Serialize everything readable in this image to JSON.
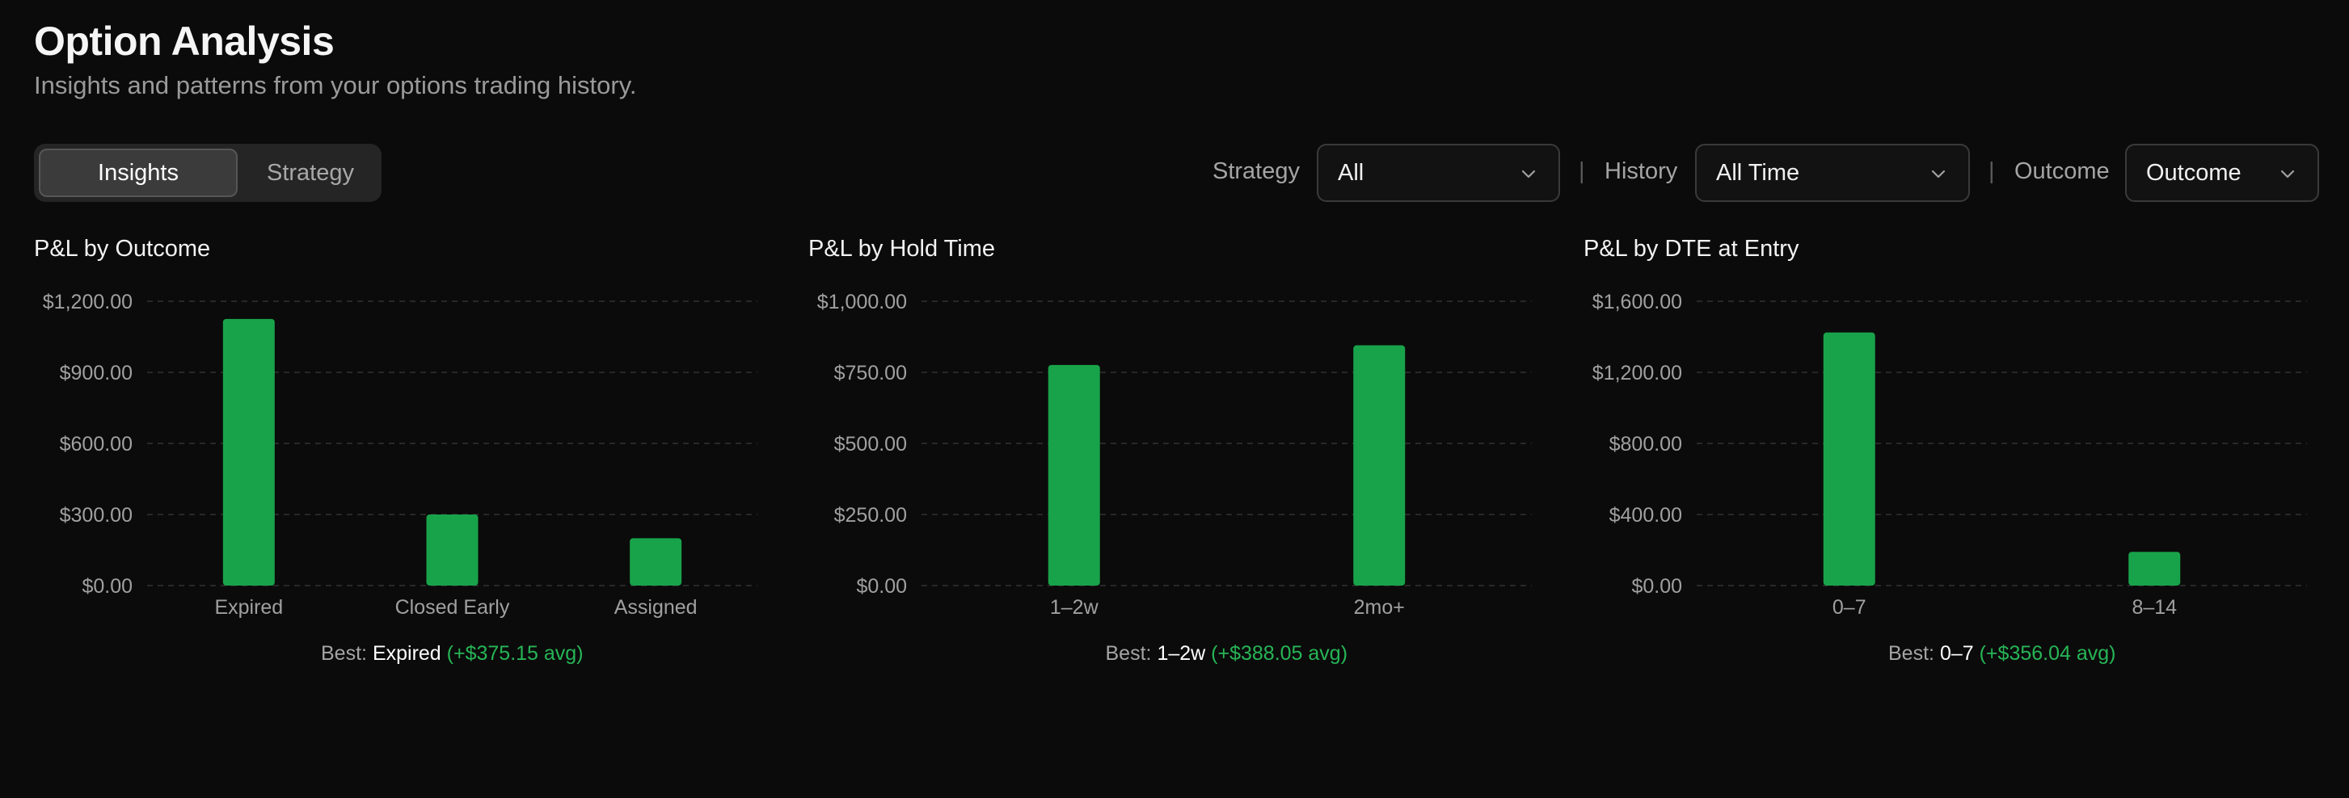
{
  "header": {
    "title": "Option Analysis",
    "subtitle": "Insights and patterns from your options trading history."
  },
  "tabs": [
    {
      "label": "Insights",
      "active": true
    },
    {
      "label": "Strategy",
      "active": false
    }
  ],
  "filters": {
    "strategy": {
      "label": "Strategy",
      "value": "All"
    },
    "history": {
      "label": "History",
      "value": "All Time"
    },
    "outcome": {
      "label": "Outcome",
      "value": "Outcome"
    },
    "separator": "|"
  },
  "colors": {
    "bar": "#18a34a",
    "accent_text": "#27b556",
    "grid": "#333333",
    "tick": "#a0a0a0"
  },
  "chart_data": [
    {
      "type": "bar",
      "title": "P&L by Outcome",
      "categories": [
        "Expired",
        "Closed Early",
        "Assigned"
      ],
      "values": [
        1125.45,
        300,
        200
      ],
      "yticks": [
        "$0.00",
        "$300.00",
        "$600.00",
        "$900.00",
        "$1,200.00"
      ],
      "ylim": [
        0,
        1200
      ],
      "grid": true,
      "best": {
        "prefix": "Best:",
        "category": "Expired",
        "avg": "(+$375.15 avg)"
      }
    },
    {
      "type": "bar",
      "title": "P&L by Hold Time",
      "categories": [
        "1–2w",
        "2mo+"
      ],
      "values": [
        776.1,
        845
      ],
      "yticks": [
        "$0.00",
        "$250.00",
        "$500.00",
        "$750.00",
        "$1,000.00"
      ],
      "ylim": [
        0,
        1000
      ],
      "grid": true,
      "best": {
        "prefix": "Best:",
        "category": "1–2w",
        "avg": "(+$388.05 avg)"
      }
    },
    {
      "type": "bar",
      "title": "P&L by DTE at Entry",
      "categories": [
        "0–7",
        "8–14"
      ],
      "values": [
        1424.3,
        190
      ],
      "yticks": [
        "$0.00",
        "$400.00",
        "$800.00",
        "$1,200.00",
        "$1,600.00"
      ],
      "ylim": [
        0,
        1600
      ],
      "grid": true,
      "best": {
        "prefix": "Best:",
        "category": "0–7",
        "avg": "(+$356.04 avg)"
      }
    }
  ]
}
